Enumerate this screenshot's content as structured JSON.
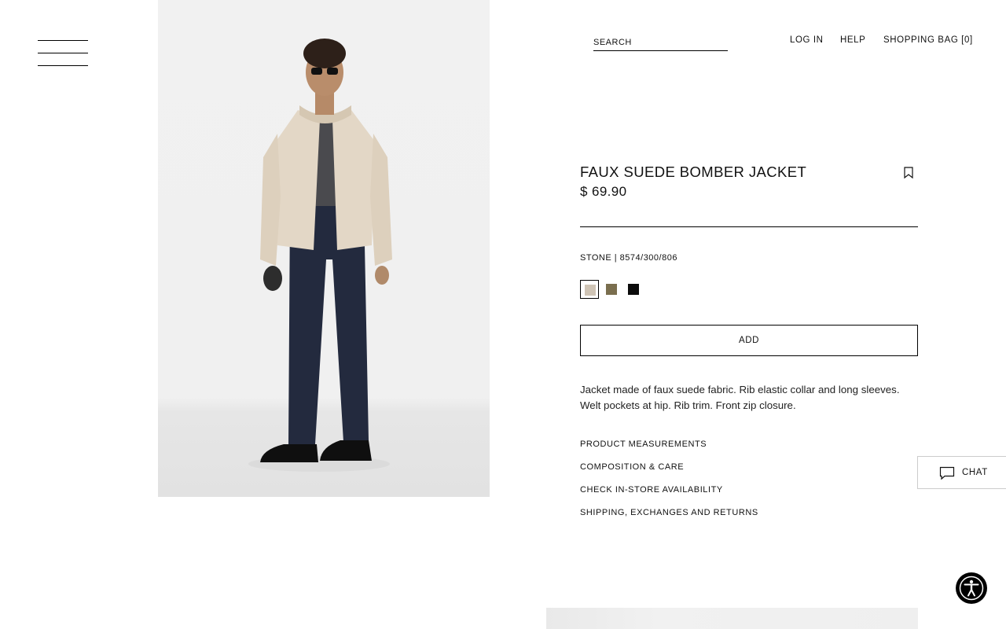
{
  "header": {
    "search_placeholder": "SEARCH",
    "login": "LOG IN",
    "help": "HELP",
    "bag": "SHOPPING BAG [0]"
  },
  "product": {
    "title": "FAUX SUEDE BOMBER JACKET",
    "price": "$ 69.90",
    "color_line": "STONE | 8574/300/806",
    "swatches": [
      {
        "color": "#cfc4b5",
        "selected": true
      },
      {
        "color": "#7a6e4e",
        "selected": false
      },
      {
        "color": "#0b0b0b",
        "selected": false
      }
    ],
    "add_label": "ADD",
    "description": "Jacket made of faux suede fabric. Rib elastic collar and long sleeves. Welt pockets at hip. Rib trim. Front zip closure.",
    "links": [
      "PRODUCT MEASUREMENTS",
      "COMPOSITION & CARE",
      "CHECK IN-STORE AVAILABILITY",
      "SHIPPING, EXCHANGES AND RETURNS"
    ]
  },
  "chat": {
    "label": "CHAT"
  },
  "icons": {
    "menu": "hamburger-menu-icon",
    "bookmark": "bookmark-icon",
    "chat": "chat-bubble-icon",
    "accessibility": "accessibility-icon"
  }
}
